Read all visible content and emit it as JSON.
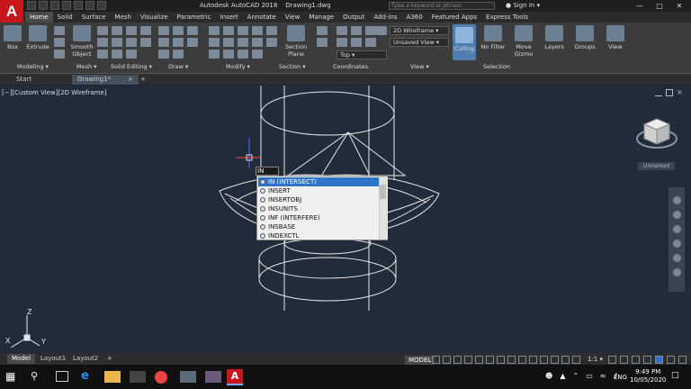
{
  "title_bar": {
    "app_title": "Autodesk AutoCAD 2018",
    "file_name": "Drawing1.dwg",
    "search_placeholder": "Type a keyword or phrase",
    "sign_in": "Sign In",
    "logo_letter": "A"
  },
  "menu_tabs": [
    "Home",
    "Solid",
    "Surface",
    "Mesh",
    "Visualize",
    "Parametric",
    "Insert",
    "Annotate",
    "View",
    "Manage",
    "Output",
    "Add-ins",
    "A360",
    "Featured Apps",
    "Express Tools"
  ],
  "active_tab": "Home",
  "ribbon": {
    "box": "Box",
    "extrude": "Extrude",
    "smooth_object": [
      "Smooth",
      "Object"
    ],
    "section_plane": [
      "Section",
      "Plane"
    ],
    "visual_style": "2D Wireframe",
    "saved_view": "Unsaved View",
    "view_direction": "Top",
    "culling": "Culling",
    "no_filter": "No Filter",
    "move_gizmo": [
      "Move",
      "Gizmo"
    ],
    "layers": "Layers",
    "groups": "Groups",
    "view": "View",
    "panels": [
      "Modeling ▾",
      "Mesh ▾",
      "Solid Editing ▾",
      "Draw ▾",
      "Modify ▾",
      "Section ▾",
      "Coordinates",
      "View ▾",
      "Selection"
    ]
  },
  "doc_tabs": [
    "Start",
    "Drawing1*",
    "+"
  ],
  "viewport": {
    "label": "[−][Custom View][2D Wireframe]",
    "viewcube_label": "Unnamed",
    "ucs_x": "X",
    "ucs_y": "Y",
    "ucs_z": "Z"
  },
  "command": {
    "typed": "IN",
    "suggestions": [
      "IN (INTERSECT)",
      "INSERT",
      "INSERTOBJ",
      "INSUNITS",
      "INF (INTERFERE)",
      "INSBASE",
      "INDEXCTL"
    ],
    "selected_index": 0
  },
  "layout_tabs": [
    "Model",
    "Layout1",
    "Layout2",
    "+"
  ],
  "status": {
    "model": "MODEL",
    "scale": "1:1"
  },
  "taskbar": {
    "language": "ENG",
    "time": "9:49 PM",
    "date": "10/05/2020"
  },
  "colors": {
    "viewport_bg": "#212c3a",
    "accent": "#3074c9",
    "logo": "#c8161d"
  }
}
